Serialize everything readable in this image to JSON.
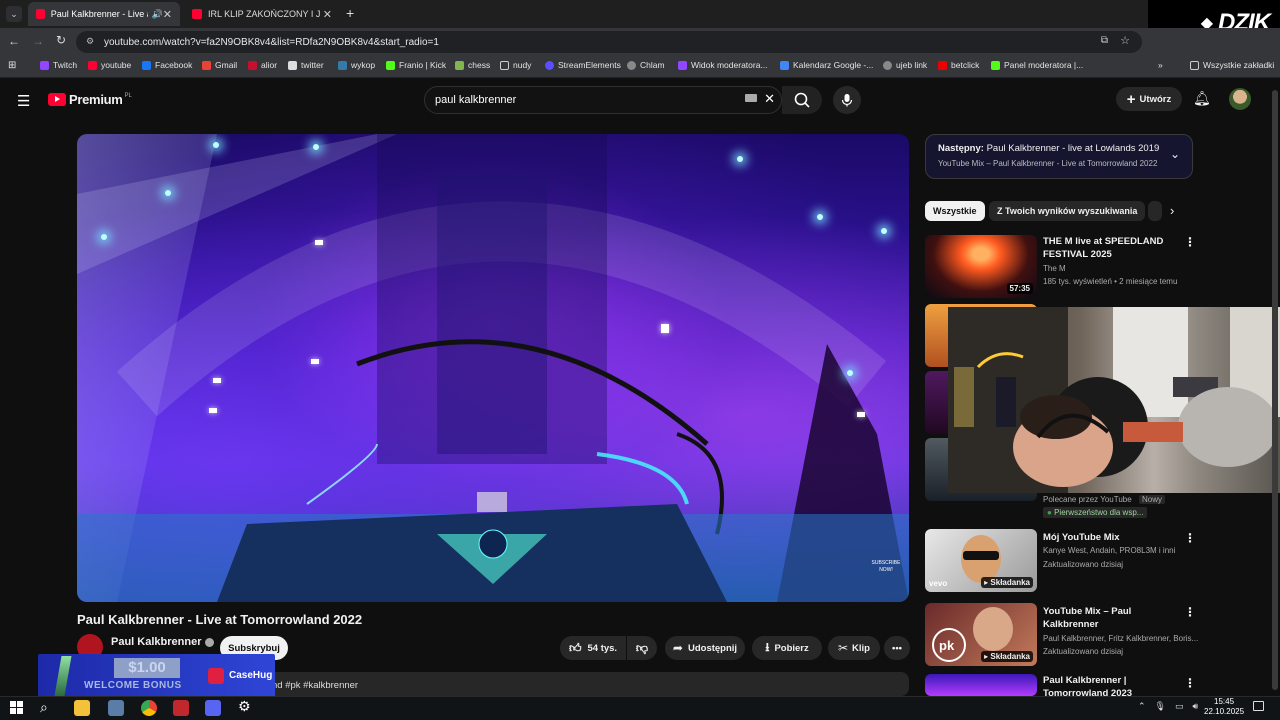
{
  "browser": {
    "tabs": [
      {
        "label": "Paul Kalkbrenner - Live at T",
        "active": true
      },
      {
        "label": "IRL KLIP ZAKOŃCZONY I JEDZI",
        "active": false
      }
    ],
    "url": "youtube.com/watch?v=fa2N9OBK8v4&list=RDfa2N9OBK8v4&start_radio=1",
    "bookmarks": [
      "Twitch",
      "youtube",
      "Facebook",
      "Gmail",
      "alior",
      "twitter",
      "wykop",
      "Franio | Kick",
      "chess",
      "nudy",
      "StreamElements",
      "Chlam",
      "Widok moderatora...",
      "Kalendarz Google -...",
      "ujeb link",
      "betclick",
      "Panel moderatora |..."
    ],
    "all_bookmarks": "Wszystkie zakładki",
    "streamer_logo": "DZIK"
  },
  "yt": {
    "logo": "Premium",
    "region": "PL",
    "search_value": "paul kalkbrenner",
    "create_label": "Utwórz",
    "video_title": "Paul Kalkbrenner - Live at Tomorrowland 2022",
    "channel": "Paul Kalkbrenner",
    "subscribe": "Subskrybuj",
    "likes": "54 tys.",
    "share": "Udostępnij",
    "download": "Pobierz",
    "clip": "Klip",
    "description_snippet": "nd #pk #kalkbrenner",
    "video_watermark": "SUBSCRIBE NOW!"
  },
  "sidebar": {
    "upnext_label": "Następny:",
    "upnext_title": "Paul Kalkbrenner - live at Lowlands 2019",
    "upnext_sub": "YouTube Mix – Paul Kalkbrenner - Live at Tomorrowland 2022",
    "chips": [
      "Wszystkie",
      "Z Twoich wyników wyszukiwania"
    ],
    "videos": [
      {
        "title": "THE M live at SPEEDLAND FESTIVAL 2025",
        "meta1": "The M",
        "meta2": "185 tys. wyświetleń • 2 miesiące temu",
        "duration": "57:35"
      },
      {
        "title": "Mój YouTube Mix",
        "meta1": "Kanye West, Andain, PRO8L3M i inni",
        "meta2": "Zaktualizowano dzisiaj",
        "duration": "Składanka",
        "badge": "vevo"
      },
      {
        "title": "YouTube Mix – Paul Kalkbrenner",
        "meta1": "Paul Kalkbrenner, Fritz Kalkbrenner, Boris...",
        "meta2": "Zaktualizowano dzisiaj",
        "duration": "Składanka"
      },
      {
        "title": "Paul Kalkbrenner | Tomorrowland 2023",
        "meta1": "",
        "meta2": "",
        "duration": ""
      }
    ],
    "partial_meta": {
      "recommended": "Polecane przez YouTube",
      "new": "Nowy",
      "premium": "Pierwszeństwo dla wsp..."
    }
  },
  "promo": {
    "amount": "$1.00",
    "text": "WELCOME BONUS",
    "brand": "CaseHug"
  },
  "taskbar": {
    "time": "15:45",
    "date": "22.10.2025"
  }
}
